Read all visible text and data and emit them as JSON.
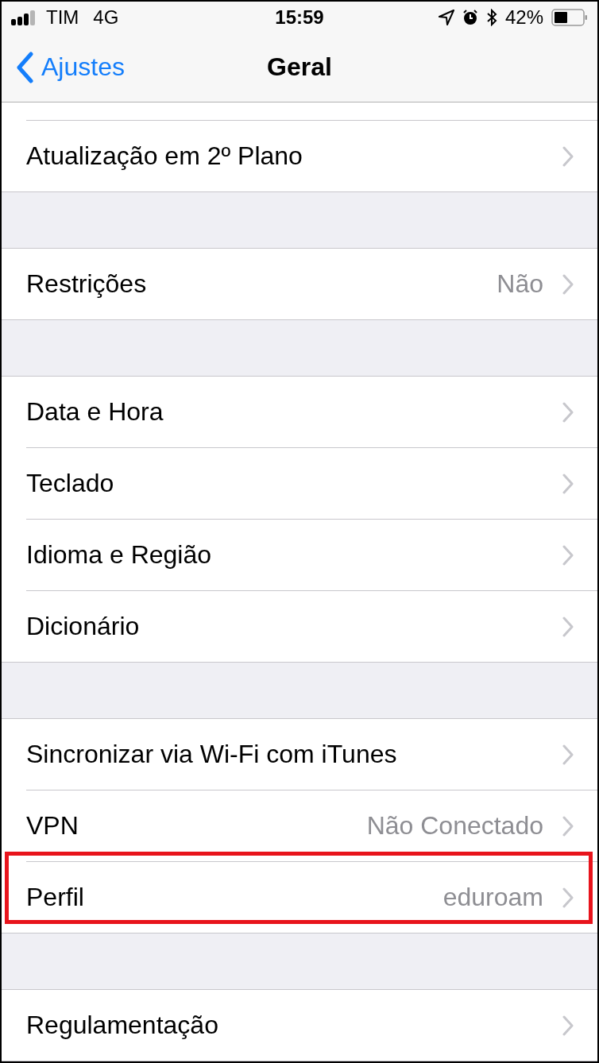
{
  "status_bar": {
    "carrier": "TIM",
    "network": "4G",
    "time": "15:59",
    "battery": "42%"
  },
  "nav_bar": {
    "back": "Ajustes",
    "title": "Geral"
  },
  "groups": [
    {
      "rows": [
        {
          "label": "Atualização em 2º Plano",
          "highlighted": false
        }
      ]
    },
    {
      "rows": [
        {
          "label": "Restrições",
          "value": "Não",
          "highlighted": false
        }
      ]
    },
    {
      "rows": [
        {
          "label": "Data e Hora",
          "highlighted": false
        },
        {
          "label": "Teclado",
          "highlighted": false
        },
        {
          "label": "Idioma e Região",
          "highlighted": false
        },
        {
          "label": "Dicionário",
          "highlighted": false
        }
      ]
    },
    {
      "rows": [
        {
          "label": "Sincronizar via Wi-Fi com iTunes",
          "highlighted": false
        },
        {
          "label": "VPN",
          "value": "Não Conectado",
          "highlighted": false
        },
        {
          "label": "Perfil",
          "value": "eduroam",
          "highlighted": true
        }
      ]
    },
    {
      "rows": [
        {
          "label": "Regulamentação",
          "highlighted": false
        }
      ]
    }
  ]
}
